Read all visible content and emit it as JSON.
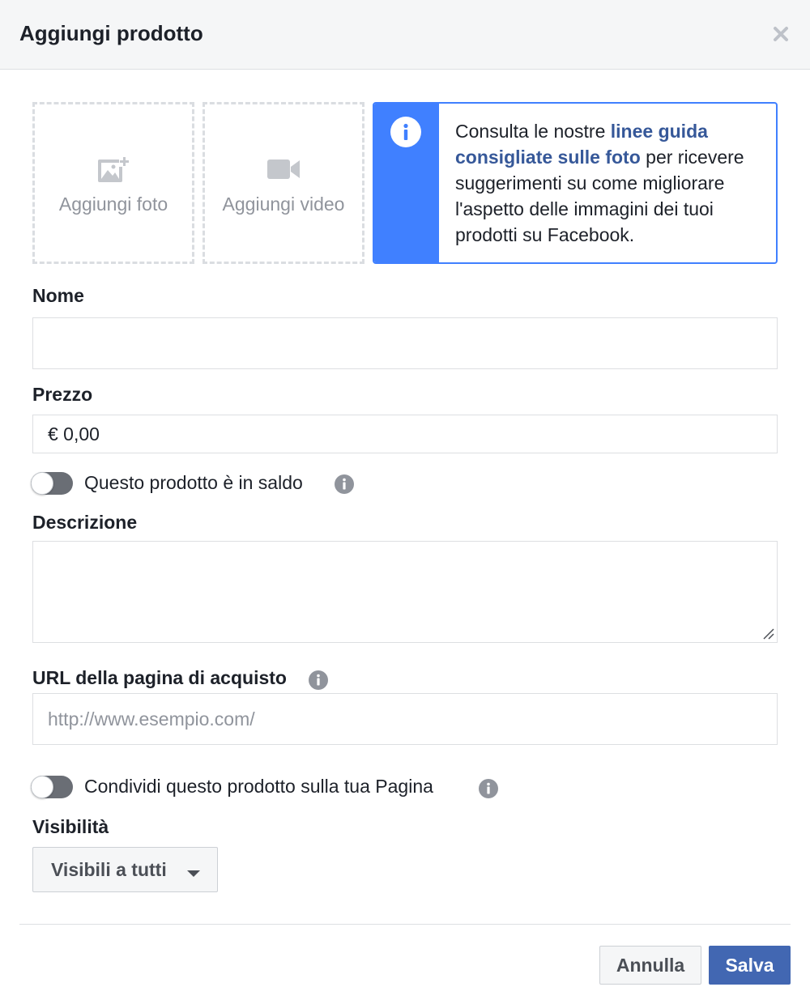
{
  "dialog": {
    "title": "Aggiungi prodotto"
  },
  "media": {
    "add_photo_label": "Aggiungi foto",
    "add_video_label": "Aggiungi video",
    "photo_icon": "add-photo-icon",
    "video_icon": "video-camera-icon"
  },
  "info": {
    "text_before": "Consulta le nostre ",
    "link_text": "linee guida consigliate sulle foto",
    "text_after": " per ricevere suggerimenti su come migliorare l'aspetto delle immagini dei tuoi prodotti su Facebook."
  },
  "form": {
    "name_label": "Nome",
    "name_value": "",
    "price_label": "Prezzo",
    "price_value": "€ 0,00",
    "sale_toggle_label": "Questo prodotto è in saldo",
    "sale_toggle_on": false,
    "description_label": "Descrizione",
    "description_value": "",
    "url_label": "URL della pagina di acquisto",
    "url_placeholder": "http://www.esempio.com/",
    "share_toggle_label": "Condividi questo prodotto sulla tua Pagina",
    "share_toggle_on": false,
    "visibility_label": "Visibilità",
    "visibility_value": "Visibili a tutti"
  },
  "footer": {
    "cancel_label": "Annulla",
    "save_label": "Salva"
  },
  "colors": {
    "accent": "#4080ff",
    "primary_button": "#4267b2",
    "link": "#365899"
  }
}
